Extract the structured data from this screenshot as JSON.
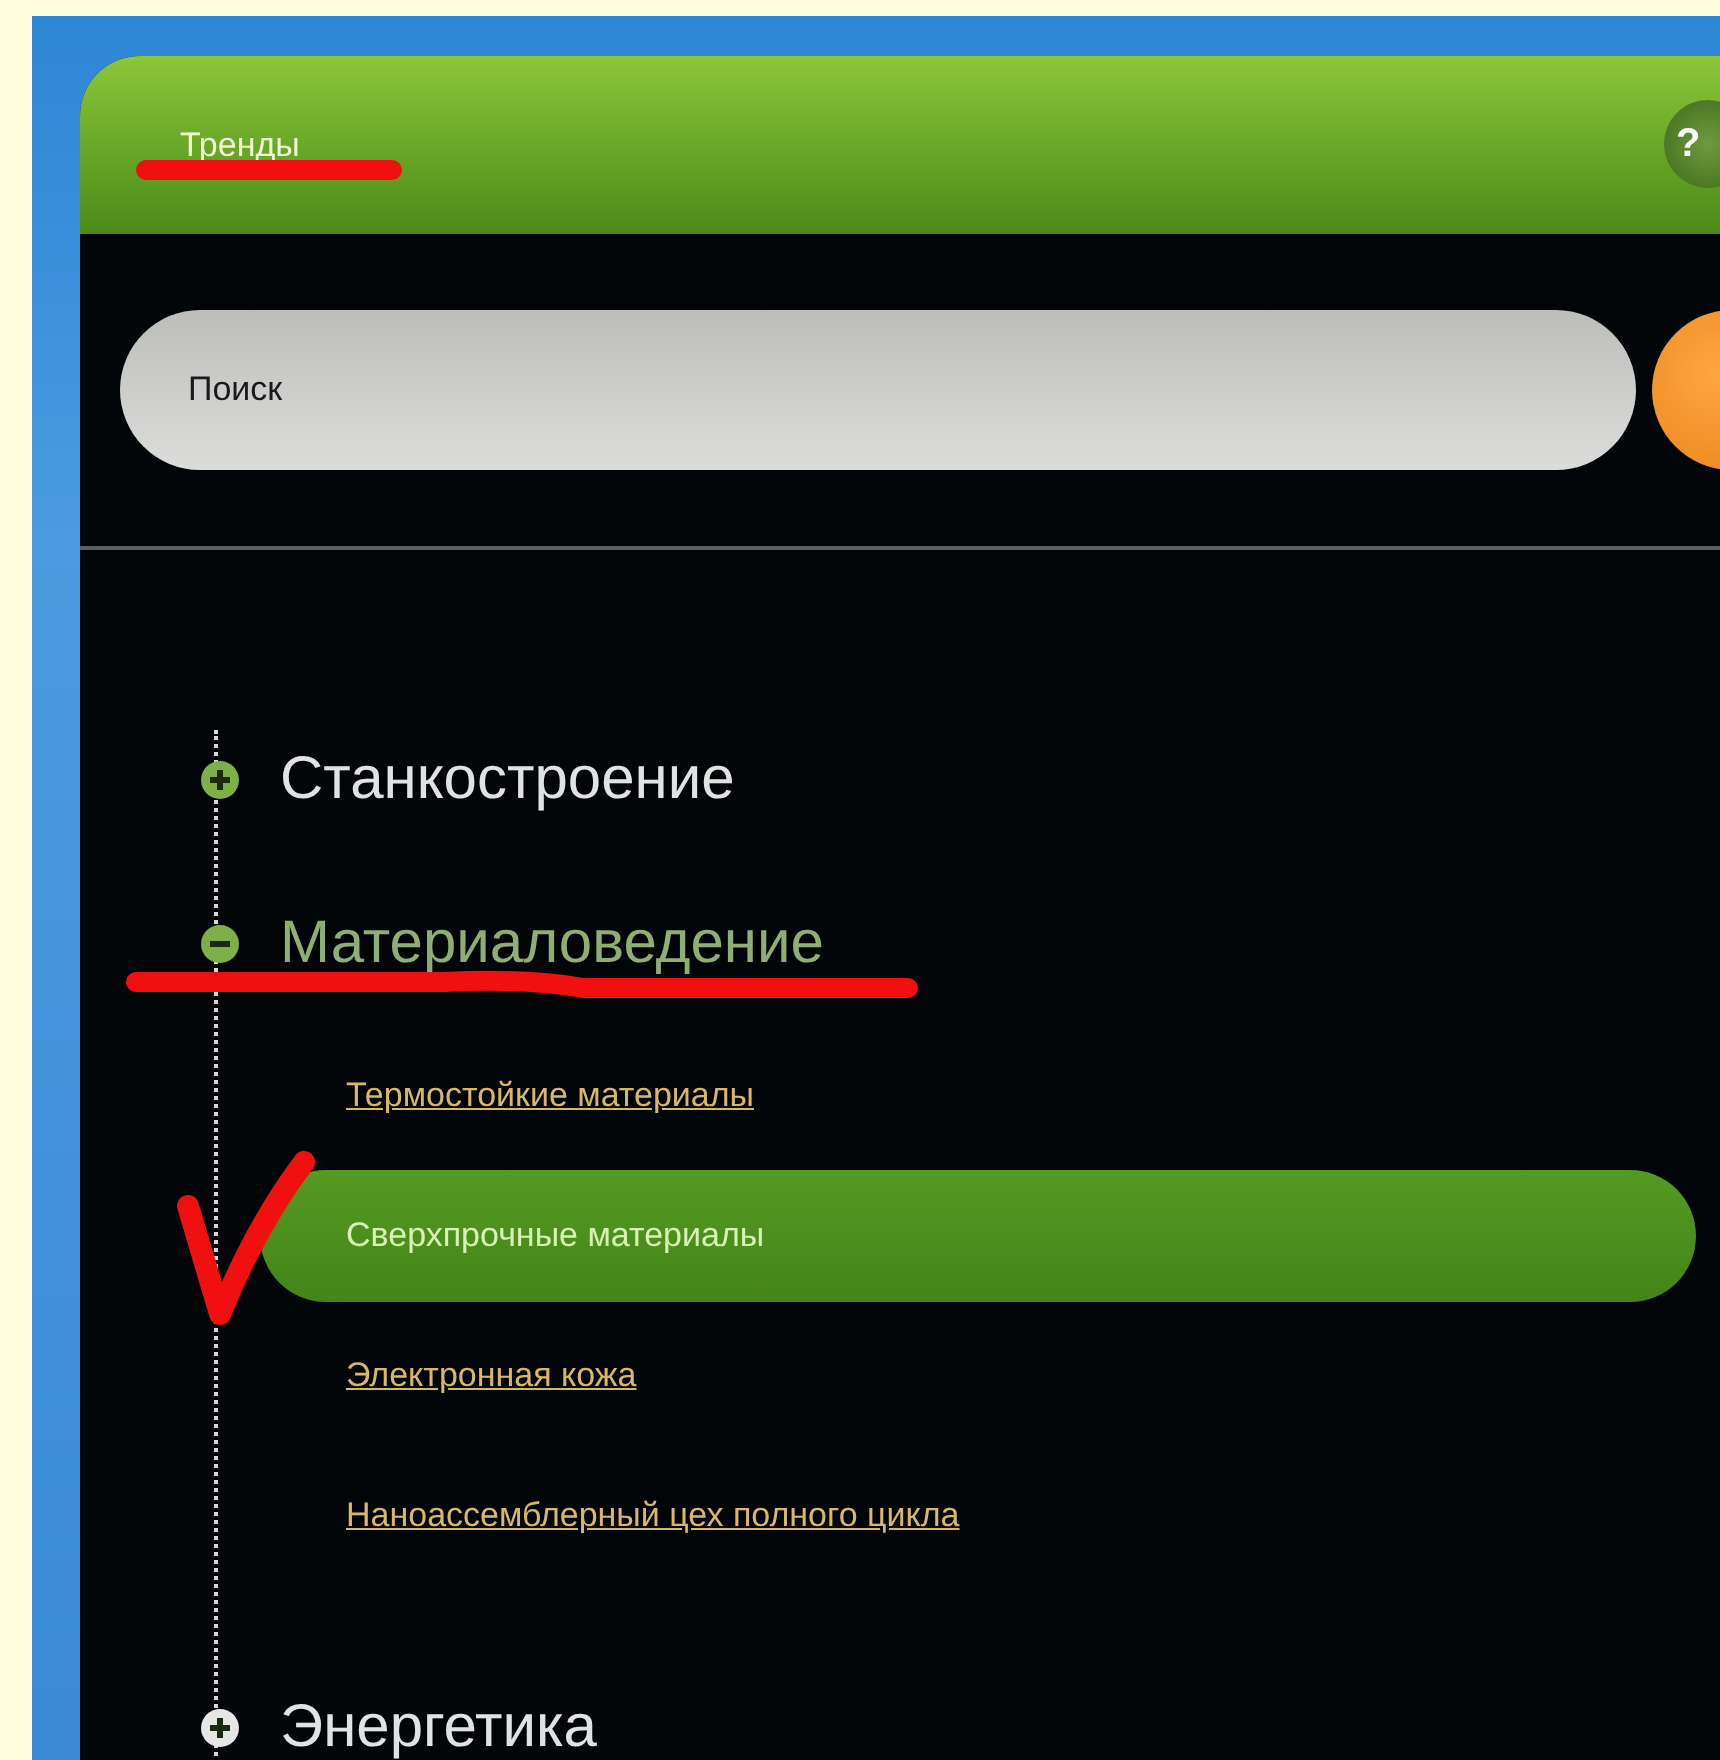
{
  "header": {
    "title": "Тренды",
    "help": "?",
    "annotated": true
  },
  "search": {
    "placeholder": "Поиск"
  },
  "tree": [
    {
      "label": "Станкостроение",
      "expanded": false,
      "color": "#7fb048",
      "annotated": false
    },
    {
      "label": "Материаловедение",
      "expanded": true,
      "color": "#7fb048",
      "annotated": true,
      "children": [
        {
          "label": "Термостойкие материалы",
          "selected": false,
          "annotated": false
        },
        {
          "label": "Сверхпрочные материалы",
          "selected": true,
          "annotated": true
        },
        {
          "label": "Электронная кожа",
          "selected": false,
          "annotated": false
        },
        {
          "label": "Наноассемблерный цех полного цикла",
          "selected": false,
          "annotated": false
        }
      ]
    },
    {
      "label": "Энергетика",
      "expanded": false,
      "color": "#e6e6e6",
      "annotated": false
    }
  ]
}
